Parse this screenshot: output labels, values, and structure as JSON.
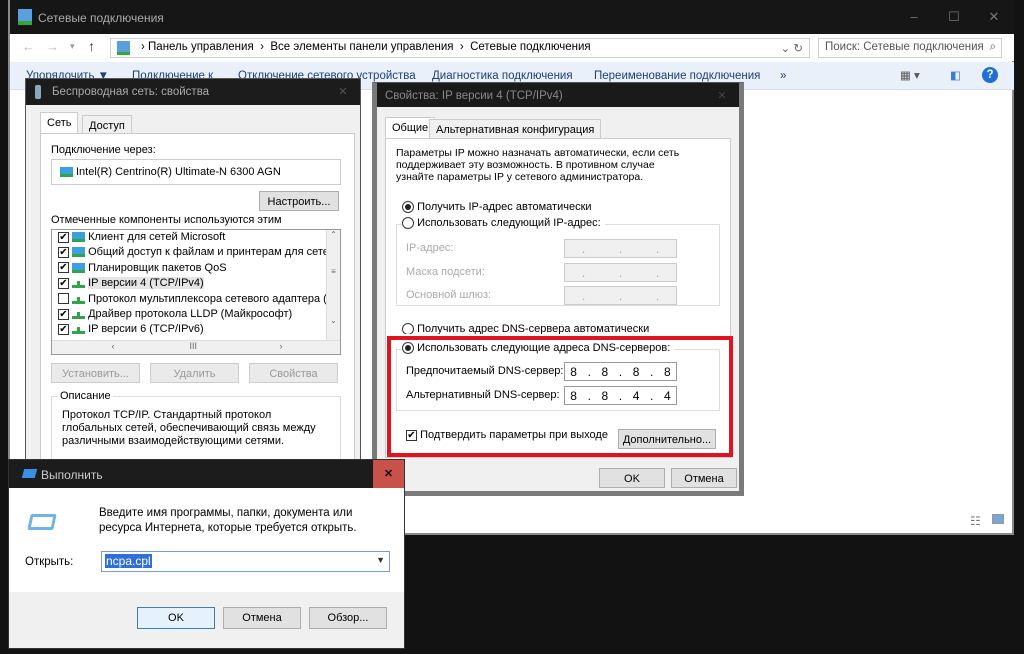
{
  "explorer": {
    "title": "Сетевые подключения",
    "breadcrumb": [
      "Панель управления",
      "Все элементы панели управления",
      "Сетевые подключения"
    ],
    "search_placeholder": "Поиск: Сетевые подключения",
    "toolbar": [
      "Упорядочить ▼",
      "Подключение к",
      "Отключение сетевого устройства",
      "Диагностика подключения",
      "Переименование подключения",
      "»"
    ]
  },
  "wireless": {
    "title": "Беспроводная сеть: свойства",
    "tabs": [
      "Сеть",
      "Доступ"
    ],
    "connect_via_label": "Подключение через:",
    "adapter": "Intel(R) Centrino(R) Ultimate-N 6300 AGN",
    "configure": "Настроить...",
    "components_label": "Отмеченные компоненты используются этим подключением:",
    "components": [
      {
        "label": "Клиент для сетей Microsoft",
        "checked": true,
        "icon": "network"
      },
      {
        "label": "Общий доступ к файлам и принтерам для сетей Mi",
        "checked": true,
        "icon": "network"
      },
      {
        "label": "Планировщик пакетов QoS",
        "checked": true,
        "icon": "network"
      },
      {
        "label": "IP версии 4 (TCP/IPv4)",
        "checked": true,
        "icon": "protocol",
        "selected": true
      },
      {
        "label": "Протокол мультиплексора сетевого адаптера (Mai",
        "checked": false,
        "icon": "protocol"
      },
      {
        "label": "Драйвер протокола LLDP (Майкрософт)",
        "checked": true,
        "icon": "protocol"
      },
      {
        "label": "IP версии 6 (TCP/IPv6)",
        "checked": true,
        "icon": "protocol"
      }
    ],
    "install": "Установить...",
    "remove": "Удалить",
    "properties": "Свойства",
    "description_label": "Описание",
    "description": "Протокол TCP/IP. Стандартный протокол глобальных сетей, обеспечивающий связь между различными взаимодействующими сетями."
  },
  "ipv4": {
    "title": "Свойства: IP версии 4 (TCP/IPv4)",
    "tabs": [
      "Общие",
      "Альтернативная конфигурация"
    ],
    "intro": "Параметры IP можно назначать автоматически, если сеть поддерживает эту возможность. В противном случае узнайте параметры IP у сетевого администратора.",
    "auto_ip": "Получить IP-адрес автоматически",
    "manual_ip": "Использовать следующий IP-адрес:",
    "ip_label": "IP-адрес:",
    "mask_label": "Маска подсети:",
    "gateway_label": "Основной шлюз:",
    "auto_dns": "Получить адрес DNS-сервера автоматически",
    "manual_dns": "Использовать следующие адреса DNS-серверов:",
    "preferred_label": "Предпочитаемый DNS-сервер:",
    "preferred": [
      "8",
      "8",
      "8",
      "8"
    ],
    "alternate_label": "Альтернативный DNS-сервер:",
    "alternate": [
      "8",
      "8",
      "4",
      "4"
    ],
    "validate": "Подтвердить параметры при выходе",
    "advanced": "Дополнительно...",
    "ok": "OK",
    "cancel": "Отмена",
    "highlight_color": "#e0141e"
  },
  "run": {
    "title": "Выполнить",
    "prompt": "Введите имя программы, папки, документа или ресурса Интернета, которые требуется открыть.",
    "open_label": "Открыть:",
    "value": "ncpa.cpl",
    "ok": "OK",
    "cancel": "Отмена",
    "browse": "Обзор..."
  }
}
